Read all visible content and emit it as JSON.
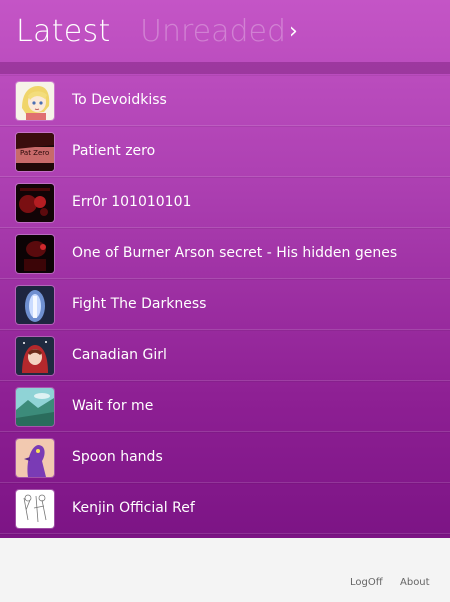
{
  "header": {
    "tab_latest": "Latest",
    "tab_unread": "Unreaded",
    "chevron": "›"
  },
  "list": {
    "items": [
      {
        "title": "To Devoidkiss",
        "thumb": "blonde-character-thumbnail"
      },
      {
        "title": "Patient zero",
        "thumb": "red-dark-art-thumbnail",
        "thumb_text": "Pat Zero"
      },
      {
        "title": "Err0r 101010101",
        "thumb": "dark-red-art-thumbnail"
      },
      {
        "title": "One of Burner Arson secret - His hidden genes",
        "thumb": "dark-red-character-thumbnail"
      },
      {
        "title": "Fight The Darkness",
        "thumb": "blue-glow-thumbnail"
      },
      {
        "title": "Canadian Girl",
        "thumb": "red-hood-girl-thumbnail"
      },
      {
        "title": "Wait for me",
        "thumb": "teal-landscape-thumbnail"
      },
      {
        "title": "Spoon hands",
        "thumb": "purple-creature-thumbnail"
      },
      {
        "title": "Kenjin Official Ref",
        "thumb": "sketch-reference-thumbnail"
      },
      {
        "title": "",
        "thumb": "partial-colorful-thumbnail"
      }
    ]
  },
  "footer": {
    "logoff": "LogOff",
    "about": "About"
  },
  "colors": {
    "accent_top": "#c455c6",
    "accent_bottom": "#7c1485"
  }
}
